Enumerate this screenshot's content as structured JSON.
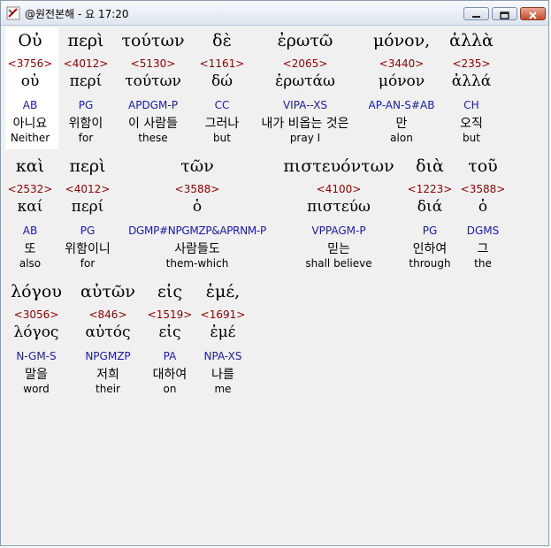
{
  "window": {
    "title": "@원전본해 - 요 17:20"
  },
  "rows": [
    [
      {
        "greek": "Οὐ",
        "strong": "<3756>",
        "lemma": "οὐ",
        "morph": "AB",
        "korean": "아니요",
        "english": "Neither"
      },
      {
        "greek": "περὶ",
        "strong": "<4012>",
        "lemma": "περί",
        "morph": "PG",
        "korean": "위함이",
        "english": "for"
      },
      {
        "greek": "τούτων",
        "strong": "<5130>",
        "lemma": "τούτων",
        "morph": "APDGM-P",
        "korean": "이 사람들",
        "english": "these"
      },
      {
        "greek": "δὲ",
        "strong": "<1161>",
        "lemma": "δώ",
        "morph": "CC",
        "korean": "그러나",
        "english": "but"
      },
      {
        "greek": "ἐρωτῶ",
        "strong": "<2065>",
        "lemma": "ἐρωτάω",
        "morph": "VIPA--XS",
        "korean": "내가 비옵는 것은",
        "english": "pray I"
      },
      {
        "greek": "μόνον,",
        "strong": "<3440>",
        "lemma": "μόνον",
        "morph": "AP-AN-S#AB",
        "korean": "만",
        "english": "alon"
      },
      {
        "greek": "ἀλλὰ",
        "strong": "<235>",
        "lemma": "ἀλλά",
        "morph": "CH",
        "korean": "오직",
        "english": "but"
      }
    ],
    [
      {
        "greek": "καὶ",
        "strong": "<2532>",
        "lemma": "καί",
        "morph": "AB",
        "korean": "또",
        "english": "also"
      },
      {
        "greek": "περὶ",
        "strong": "<4012>",
        "lemma": "περί",
        "morph": "PG",
        "korean": "위함이니",
        "english": "for"
      },
      {
        "greek": "τῶν",
        "strong": "<3588>",
        "lemma": "ὁ",
        "morph": "DGMP#NPGMZP&APRNM-P",
        "korean": "사람들도",
        "english": "them-which"
      },
      {
        "greek": "πιστευόντων",
        "strong": "<4100>",
        "lemma": "πιστεύω",
        "morph": "VPPAGM-P",
        "korean": "믿는",
        "english": "shall believe"
      },
      {
        "greek": "διὰ",
        "strong": "<1223>",
        "lemma": "διά",
        "morph": "PG",
        "korean": "인하여",
        "english": "through"
      },
      {
        "greek": "τοῦ",
        "strong": "<3588>",
        "lemma": "ὁ",
        "morph": "DGMS",
        "korean": "그",
        "english": "the"
      }
    ],
    [
      {
        "greek": "λόγου",
        "strong": "<3056>",
        "lemma": "λόγος",
        "morph": "N-GM-S",
        "korean": "말을",
        "english": "word"
      },
      {
        "greek": "αὐτῶν",
        "strong": "<846>",
        "lemma": "αὐτός",
        "morph": "NPGMZP",
        "korean": "저희",
        "english": "their"
      },
      {
        "greek": "εἰς",
        "strong": "<1519>",
        "lemma": "εἰς",
        "morph": "PA",
        "korean": "대하여",
        "english": "on"
      },
      {
        "greek": "ἐμέ,",
        "strong": "<1691>",
        "lemma": "ἐμέ",
        "morph": "NPA-XS",
        "korean": "나를",
        "english": "me"
      }
    ]
  ]
}
